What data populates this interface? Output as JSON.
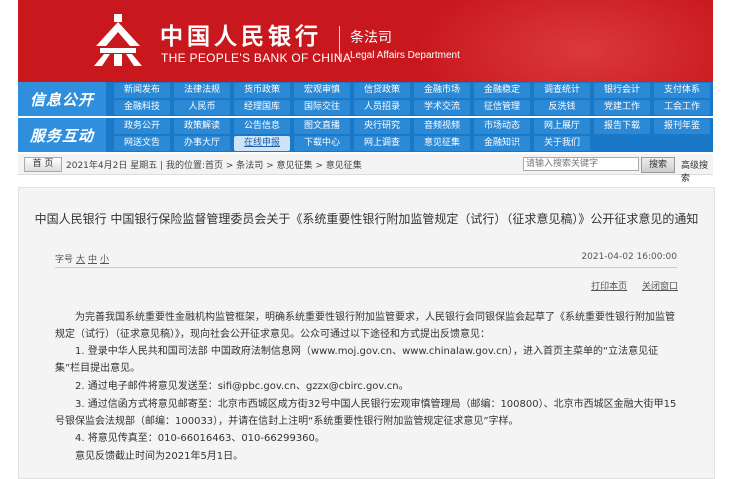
{
  "header": {
    "title_cn": "中国人民银行",
    "title_en": "THE PEOPLE'S BANK OF CHINA",
    "dept_cn": "条法司",
    "dept_en": "Legal Affairs Department"
  },
  "nav1": {
    "label": "信息公开",
    "items": [
      "新闻发布",
      "法律法规",
      "货币政策",
      "宏观审慎",
      "信贷政策",
      "金融市场",
      "金融稳定",
      "调查统计",
      "银行会计",
      "支付体系",
      "金融科技",
      "人民币",
      "经理国库",
      "国际交往",
      "人员招录",
      "学术交流",
      "征信管理",
      "反洗钱",
      "党建工作",
      "工会工作"
    ]
  },
  "nav2": {
    "label": "服务互动",
    "items": [
      "政务公开",
      "政策解读",
      "公告信息",
      "图文直播",
      "央行研究",
      "音频视频",
      "市场动态",
      "网上展厅",
      "报告下载",
      "报刊年鉴",
      "网送文告",
      "办事大厅",
      "在线申报",
      "下载中心",
      "网上调查",
      "意见征集",
      "金融知识",
      "关于我们"
    ]
  },
  "crumb": {
    "home": "首 页",
    "text": "2021年4月2日 星期五 | 我的位置:首页 > 条法司 > 意见征集 > 意见征集",
    "search_placeholder": "请输入搜索关键字",
    "search_btn": "搜索",
    "advanced": "高级搜索"
  },
  "doc": {
    "title": "中国人民银行 中国银行保险监督管理委员会关于《系统重要性银行附加监管规定（试行）（征求意见稿）》公开征求意见的通知",
    "fontsize_label": "字号",
    "fs_large": "大",
    "fs_medium": "中",
    "fs_small": "小",
    "date": "2021-04-02 16:00:00",
    "print": "打印本页",
    "close": "关闭窗口",
    "p1": "为完善我国系统重要性金融机构监管框架，明确系统重要性银行附加监管要求，人民银行会同银保监会起草了《系统重要性银行附加监管规定（试行）（征求意见稿）》，现向社会公开征求意见。公众可通过以下途径和方式提出反馈意见：",
    "p2": "1. 登录中华人民共和国司法部 中国政府法制信息网（www.moj.gov.cn、www.chinalaw.gov.cn），进入首页主菜单的“立法意见征集”栏目提出意见。",
    "p3": "2. 通过电子邮件将意见发送至：sifi@pbc.gov.cn、gzzx@cbirc.gov.cn。",
    "p4": "3. 通过信函方式将意见邮寄至：北京市西城区成方街32号中国人民银行宏观审慎管理局（邮编：100800）、北京市西城区金融大街甲15号银保监会法规部（邮编：100033），并请在信封上注明“系统重要性银行附加监管规定征求意见”字样。",
    "p5": "4. 将意见传真至：010-66016463、010-66299360。",
    "p6": "意见反馈截止时间为2021年5月1日。"
  }
}
